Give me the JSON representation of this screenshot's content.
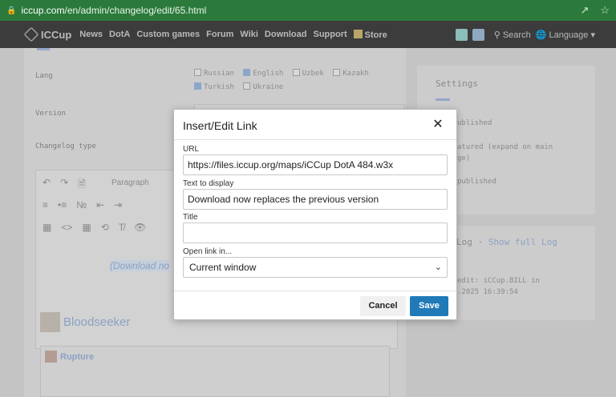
{
  "browser": {
    "url_host": "iccup.com",
    "url_path": "/en/admin/changelog/edit/65.html"
  },
  "navbar": {
    "logo_text": "ICCup",
    "items": [
      "News",
      "DotA",
      "Custom games",
      "Forum",
      "Wiki",
      "Download",
      "Support",
      "Store"
    ],
    "search_label": "Search",
    "language_label": "Language"
  },
  "form": {
    "lang_label": "Lang",
    "version_label": "Version",
    "changelog_type_label": "Changelog type",
    "languages": [
      {
        "name": "Russian",
        "checked": false
      },
      {
        "name": "English",
        "checked": true
      },
      {
        "name": "Uzbek",
        "checked": false
      },
      {
        "name": "Kazakh",
        "checked": false
      },
      {
        "name": "Turkish",
        "checked": true
      },
      {
        "name": "Ukraine",
        "checked": false
      }
    ]
  },
  "editor": {
    "block_format": "Paragraph",
    "content_visible": "(Download no",
    "hero_name": "Bloodseeker",
    "ability_name": "Rupture"
  },
  "settings": {
    "title": "Settings",
    "options": [
      "Published",
      "Featured (expand on main page)",
      "Unpublished"
    ],
    "visible_text": [
      "ublished",
      "atured (expand on main",
      "ge)",
      "published"
    ]
  },
  "log": {
    "title": "Log",
    "separator": "·",
    "show_full": "Show full Log",
    "line1": "edit: iCCup.BILL in",
    ".2025 16:39:54": ".2025 16:39:54",
    "line2": ".2025 16:39:54"
  },
  "modal": {
    "title": "Insert/Edit Link",
    "url_label": "URL",
    "url_value": "https://files.iccup.org/maps/iCCup DotA 484.w3x",
    "text_label": "Text to display",
    "text_value": "Download now replaces the previous version",
    "title_label": "Title",
    "title_value": "",
    "open_label": "Open link in...",
    "open_value": "Current window",
    "cancel_label": "Cancel",
    "save_label": "Save"
  }
}
